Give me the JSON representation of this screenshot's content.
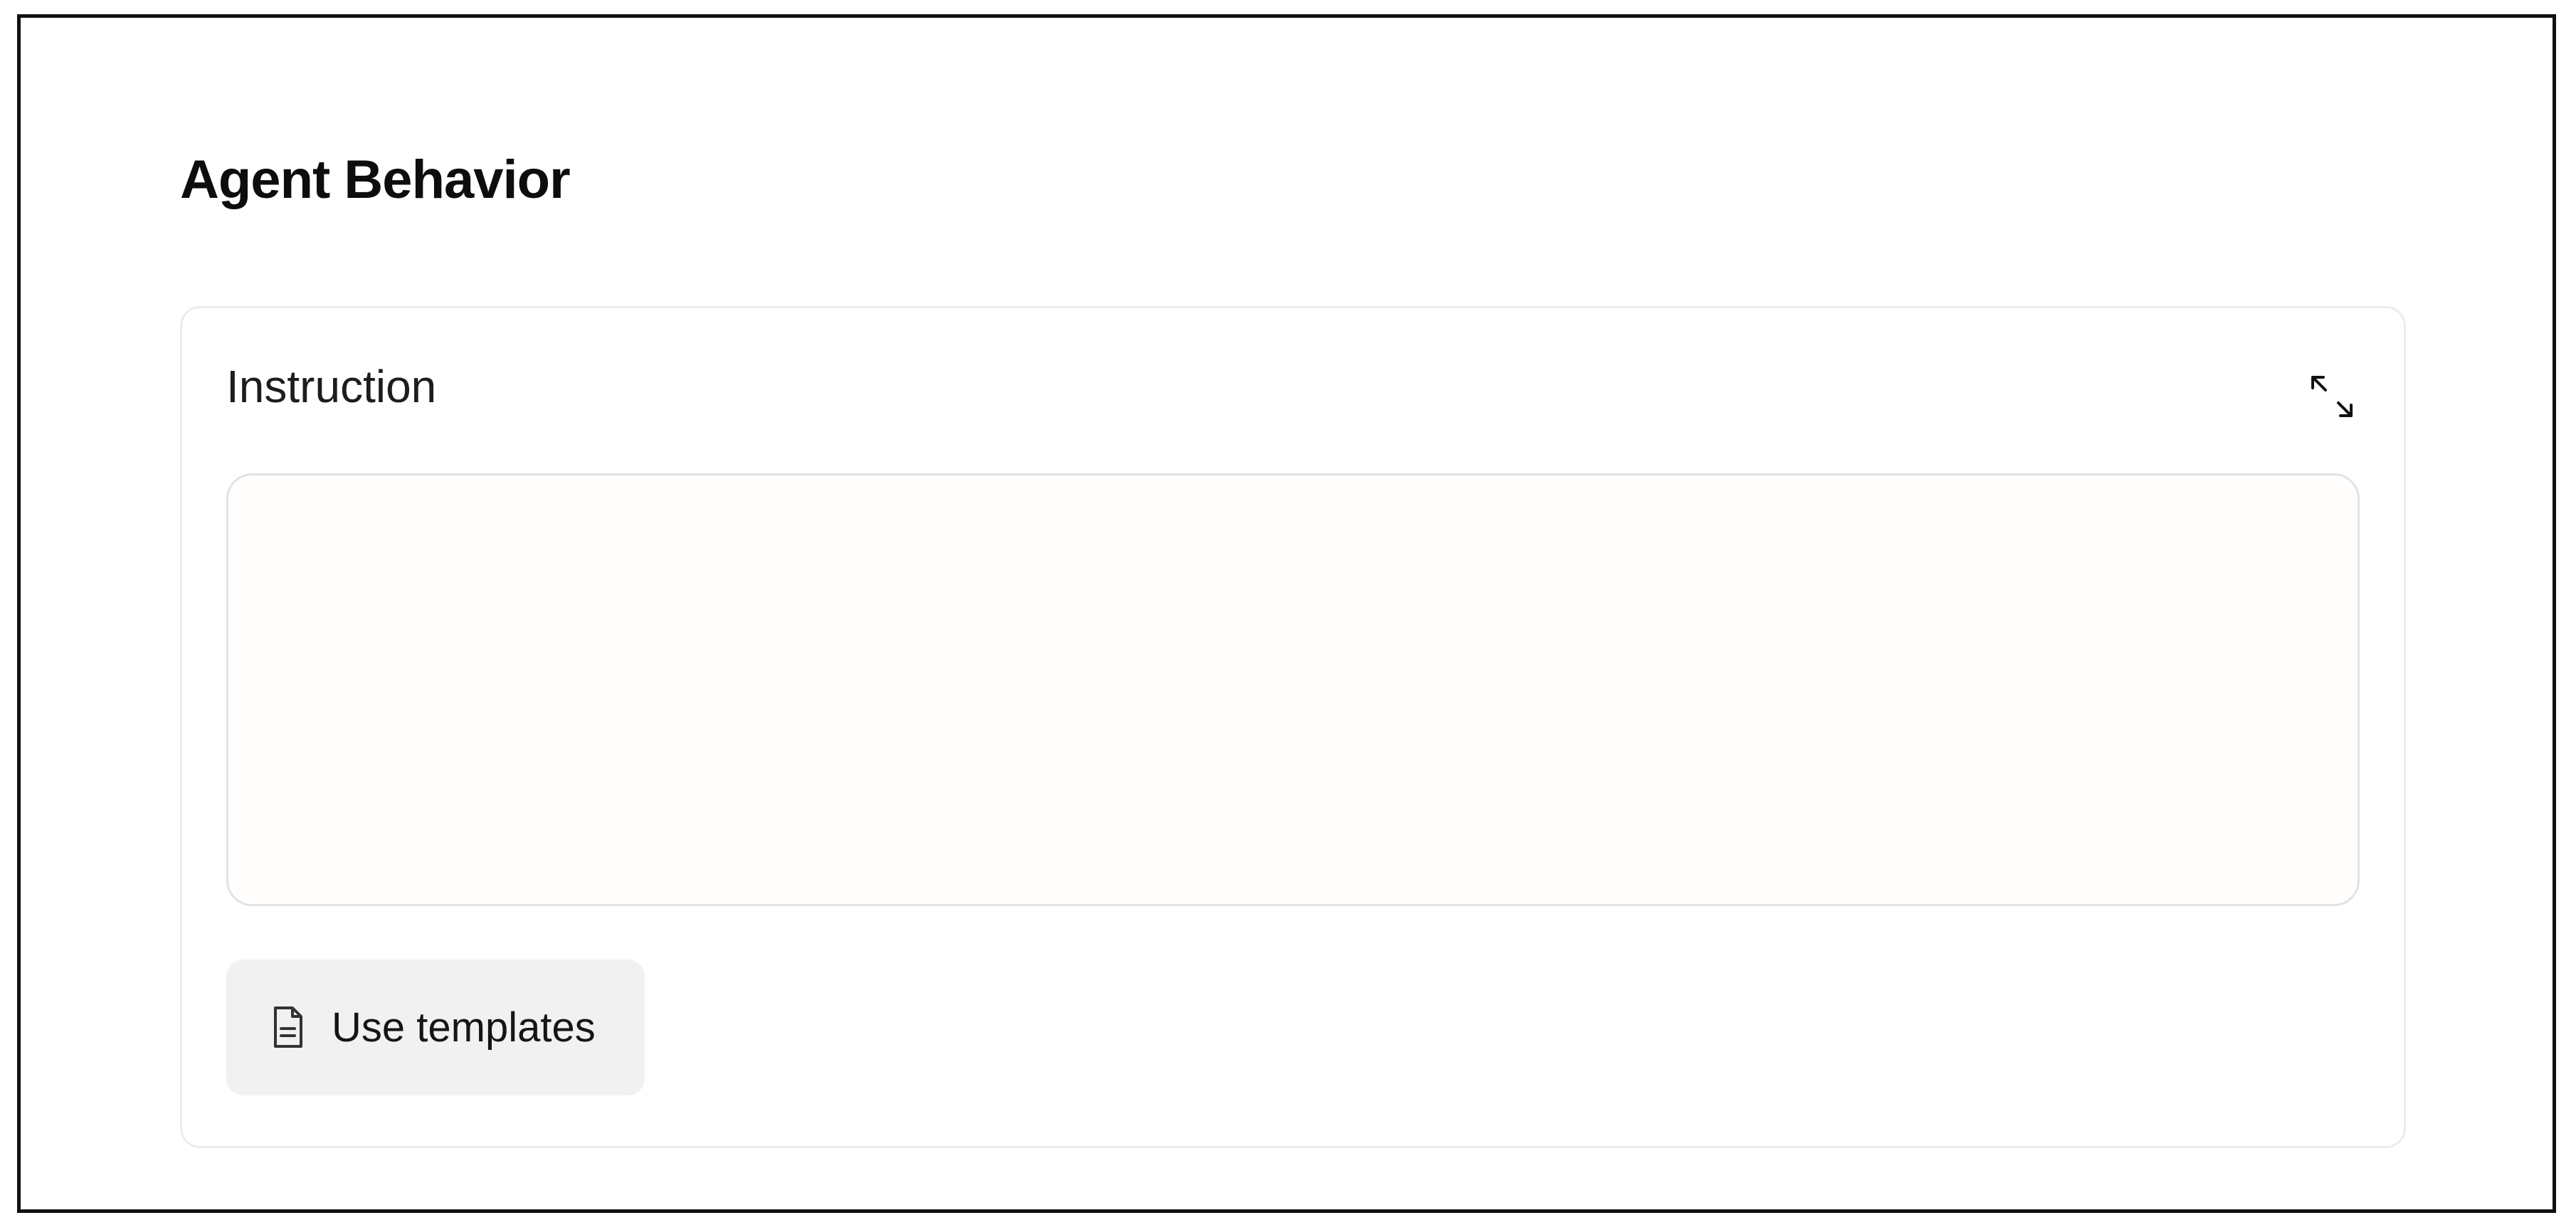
{
  "page": {
    "title": "Agent Behavior"
  },
  "instruction": {
    "label": "Instruction",
    "value": "",
    "placeholder": "",
    "expand_icon": "expand-arrows-icon"
  },
  "templates": {
    "button_label": "Use templates",
    "icon": "document-icon"
  },
  "colors": {
    "frame_border": "#111111",
    "card_border": "#ececec",
    "textarea_border": "#e3e3e3",
    "textarea_background": "#fffefc",
    "button_background": "#f1f1f1",
    "text": "#111111"
  }
}
